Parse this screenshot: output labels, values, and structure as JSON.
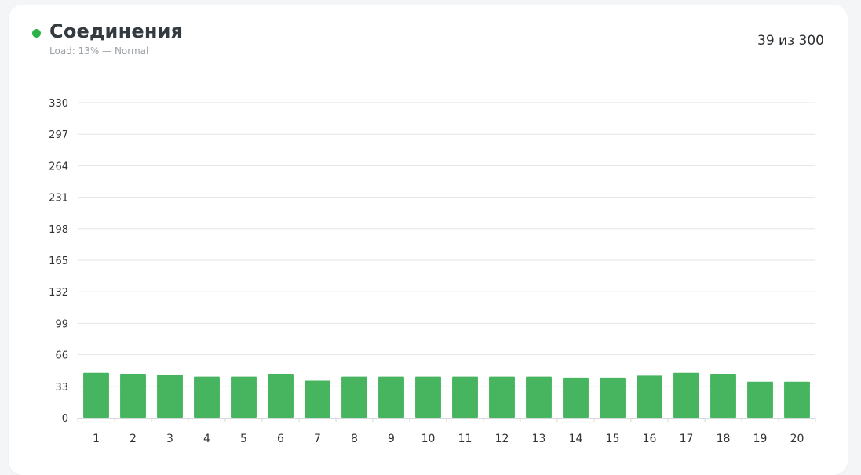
{
  "header": {
    "title": "Соединения",
    "subtitle": "Load: 13% — Normal",
    "count": "39 из 300",
    "status_color": "#2db24a"
  },
  "chart_data": {
    "type": "bar",
    "categories": [
      "1",
      "2",
      "3",
      "4",
      "5",
      "6",
      "7",
      "8",
      "9",
      "10",
      "11",
      "12",
      "13",
      "14",
      "15",
      "16",
      "17",
      "18",
      "19",
      "20"
    ],
    "values": [
      47,
      46,
      45,
      43,
      43,
      46,
      39,
      43,
      43,
      43,
      43,
      43,
      43,
      42,
      42,
      44,
      47,
      46,
      38,
      38
    ],
    "yticks": [
      0,
      33,
      66,
      99,
      132,
      165,
      198,
      231,
      264,
      297,
      330
    ],
    "ylim": [
      0,
      330
    ],
    "bar_color": "#47b45f",
    "grid": true
  }
}
